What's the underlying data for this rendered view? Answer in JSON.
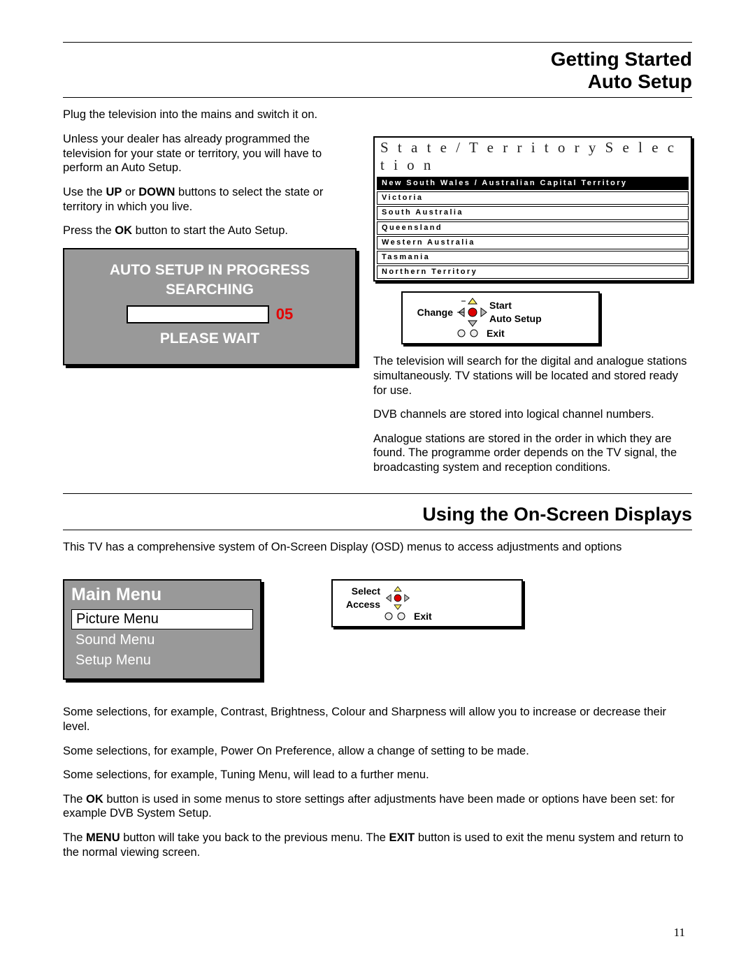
{
  "heading1_line1": "Getting Started",
  "heading1_line2": "Auto Setup",
  "intro1": "Plug the television into the mains and switch it on.",
  "intro2": "Unless your dealer has already programmed the television for your state or territory, you will have to perform an Auto Setup.",
  "intro3_pre": "Use the ",
  "intro3_up": "UP",
  "intro3_mid": " or ",
  "intro3_down": "DOWN",
  "intro3_post": " buttons to select the state or territory in which you live.",
  "intro4_pre": "Press the ",
  "intro4_ok": "OK",
  "intro4_post": " button to start the Auto Setup.",
  "state_panel": {
    "title": "S t a t e /  T e r r i t o r y S e l e c t i o n",
    "items": [
      "New South Wales / Australian Capital Territory",
      "Victoria",
      "South Australia",
      "Queensland",
      "Western Australia",
      "Tasmania",
      "Northern Territory"
    ]
  },
  "nav1": {
    "change": "Change",
    "start": "Start",
    "auto": "Auto Setup",
    "exit": "Exit"
  },
  "progress": {
    "line1": "AUTO SETUP IN PROGRESS",
    "line2": "SEARCHING",
    "count": "05",
    "line3": "PLEASE WAIT"
  },
  "search_text1": "The television will search for the digital and analogue stations simultaneously. TV stations will be located and stored ready for use.",
  "search_text2": "DVB channels are stored into logical channel numbers.",
  "search_text3": "Analogue stations are stored in the order in which they are found. The programme order depends on the TV signal, the broadcasting system and reception conditions.",
  "heading2": "Using the On-Screen Displays",
  "osd_intro": "This TV has a comprehensive system of On-Screen Display (OSD) menus to access adjustments and options",
  "main_menu": {
    "title": "Main Menu",
    "items": [
      "Picture Menu",
      "Sound Menu",
      "Setup Menu"
    ]
  },
  "nav2": {
    "select": "Select",
    "access": "Access",
    "exit": "Exit"
  },
  "para1": "Some selections, for example, Contrast, Brightness, Colour and Sharpness will allow you to increase or decrease their level.",
  "para2": "Some selections, for example, Power On Preference, allow a change of setting to be made.",
  "para3": "Some selections, for example, Tuning Menu, will lead to a further menu.",
  "para4_pre": "The ",
  "para4_ok": "OK",
  "para4_post": " button is used in some menus to store settings after adjustments have been made or options have been set: for example DVB System Setup.",
  "para5_pre": "The ",
  "para5_menu": "MENU",
  "para5_mid": " button will take you back to the previous menu. The ",
  "para5_exit": "EXIT",
  "para5_post": " button is used to exit the menu system and return to the normal viewing screen.",
  "page_number": "11"
}
